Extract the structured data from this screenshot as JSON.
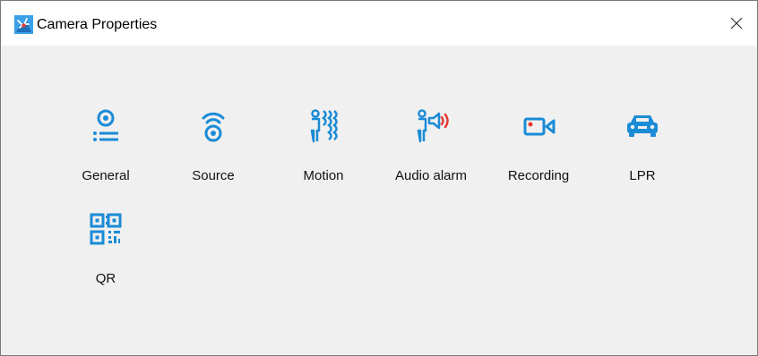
{
  "window": {
    "title": "Camera Properties",
    "icon": "camera-properties-app-icon",
    "close_icon": "close-icon"
  },
  "accent_color": "#1a8bd6",
  "alert_color": "#e53935",
  "tiles": [
    {
      "label": "General",
      "icon": "general-icon"
    },
    {
      "label": "Source",
      "icon": "source-icon"
    },
    {
      "label": "Motion",
      "icon": "motion-icon"
    },
    {
      "label": "Audio alarm",
      "icon": "audio-alarm-icon"
    },
    {
      "label": "Recording",
      "icon": "recording-icon"
    },
    {
      "label": "LPR",
      "icon": "lpr-car-icon"
    },
    {
      "label": "QR",
      "icon": "qr-code-icon"
    }
  ]
}
